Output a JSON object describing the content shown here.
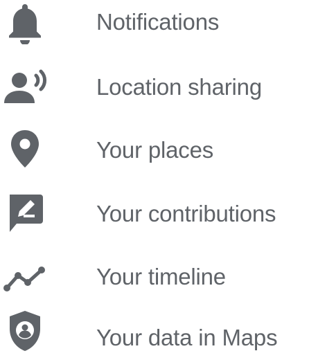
{
  "menu": {
    "items": [
      {
        "label": "Notifications",
        "icon": "bell-icon"
      },
      {
        "label": "Location sharing",
        "icon": "location-sharing-icon"
      },
      {
        "label": "Your places",
        "icon": "place-pin-icon"
      },
      {
        "label": "Your contributions",
        "icon": "contributions-icon"
      },
      {
        "label": "Your timeline",
        "icon": "timeline-icon"
      },
      {
        "label": "Your data in Maps",
        "icon": "data-shield-icon"
      }
    ]
  },
  "colors": {
    "icon": "#5f6368",
    "text": "#5f6368",
    "background": "#ffffff"
  }
}
